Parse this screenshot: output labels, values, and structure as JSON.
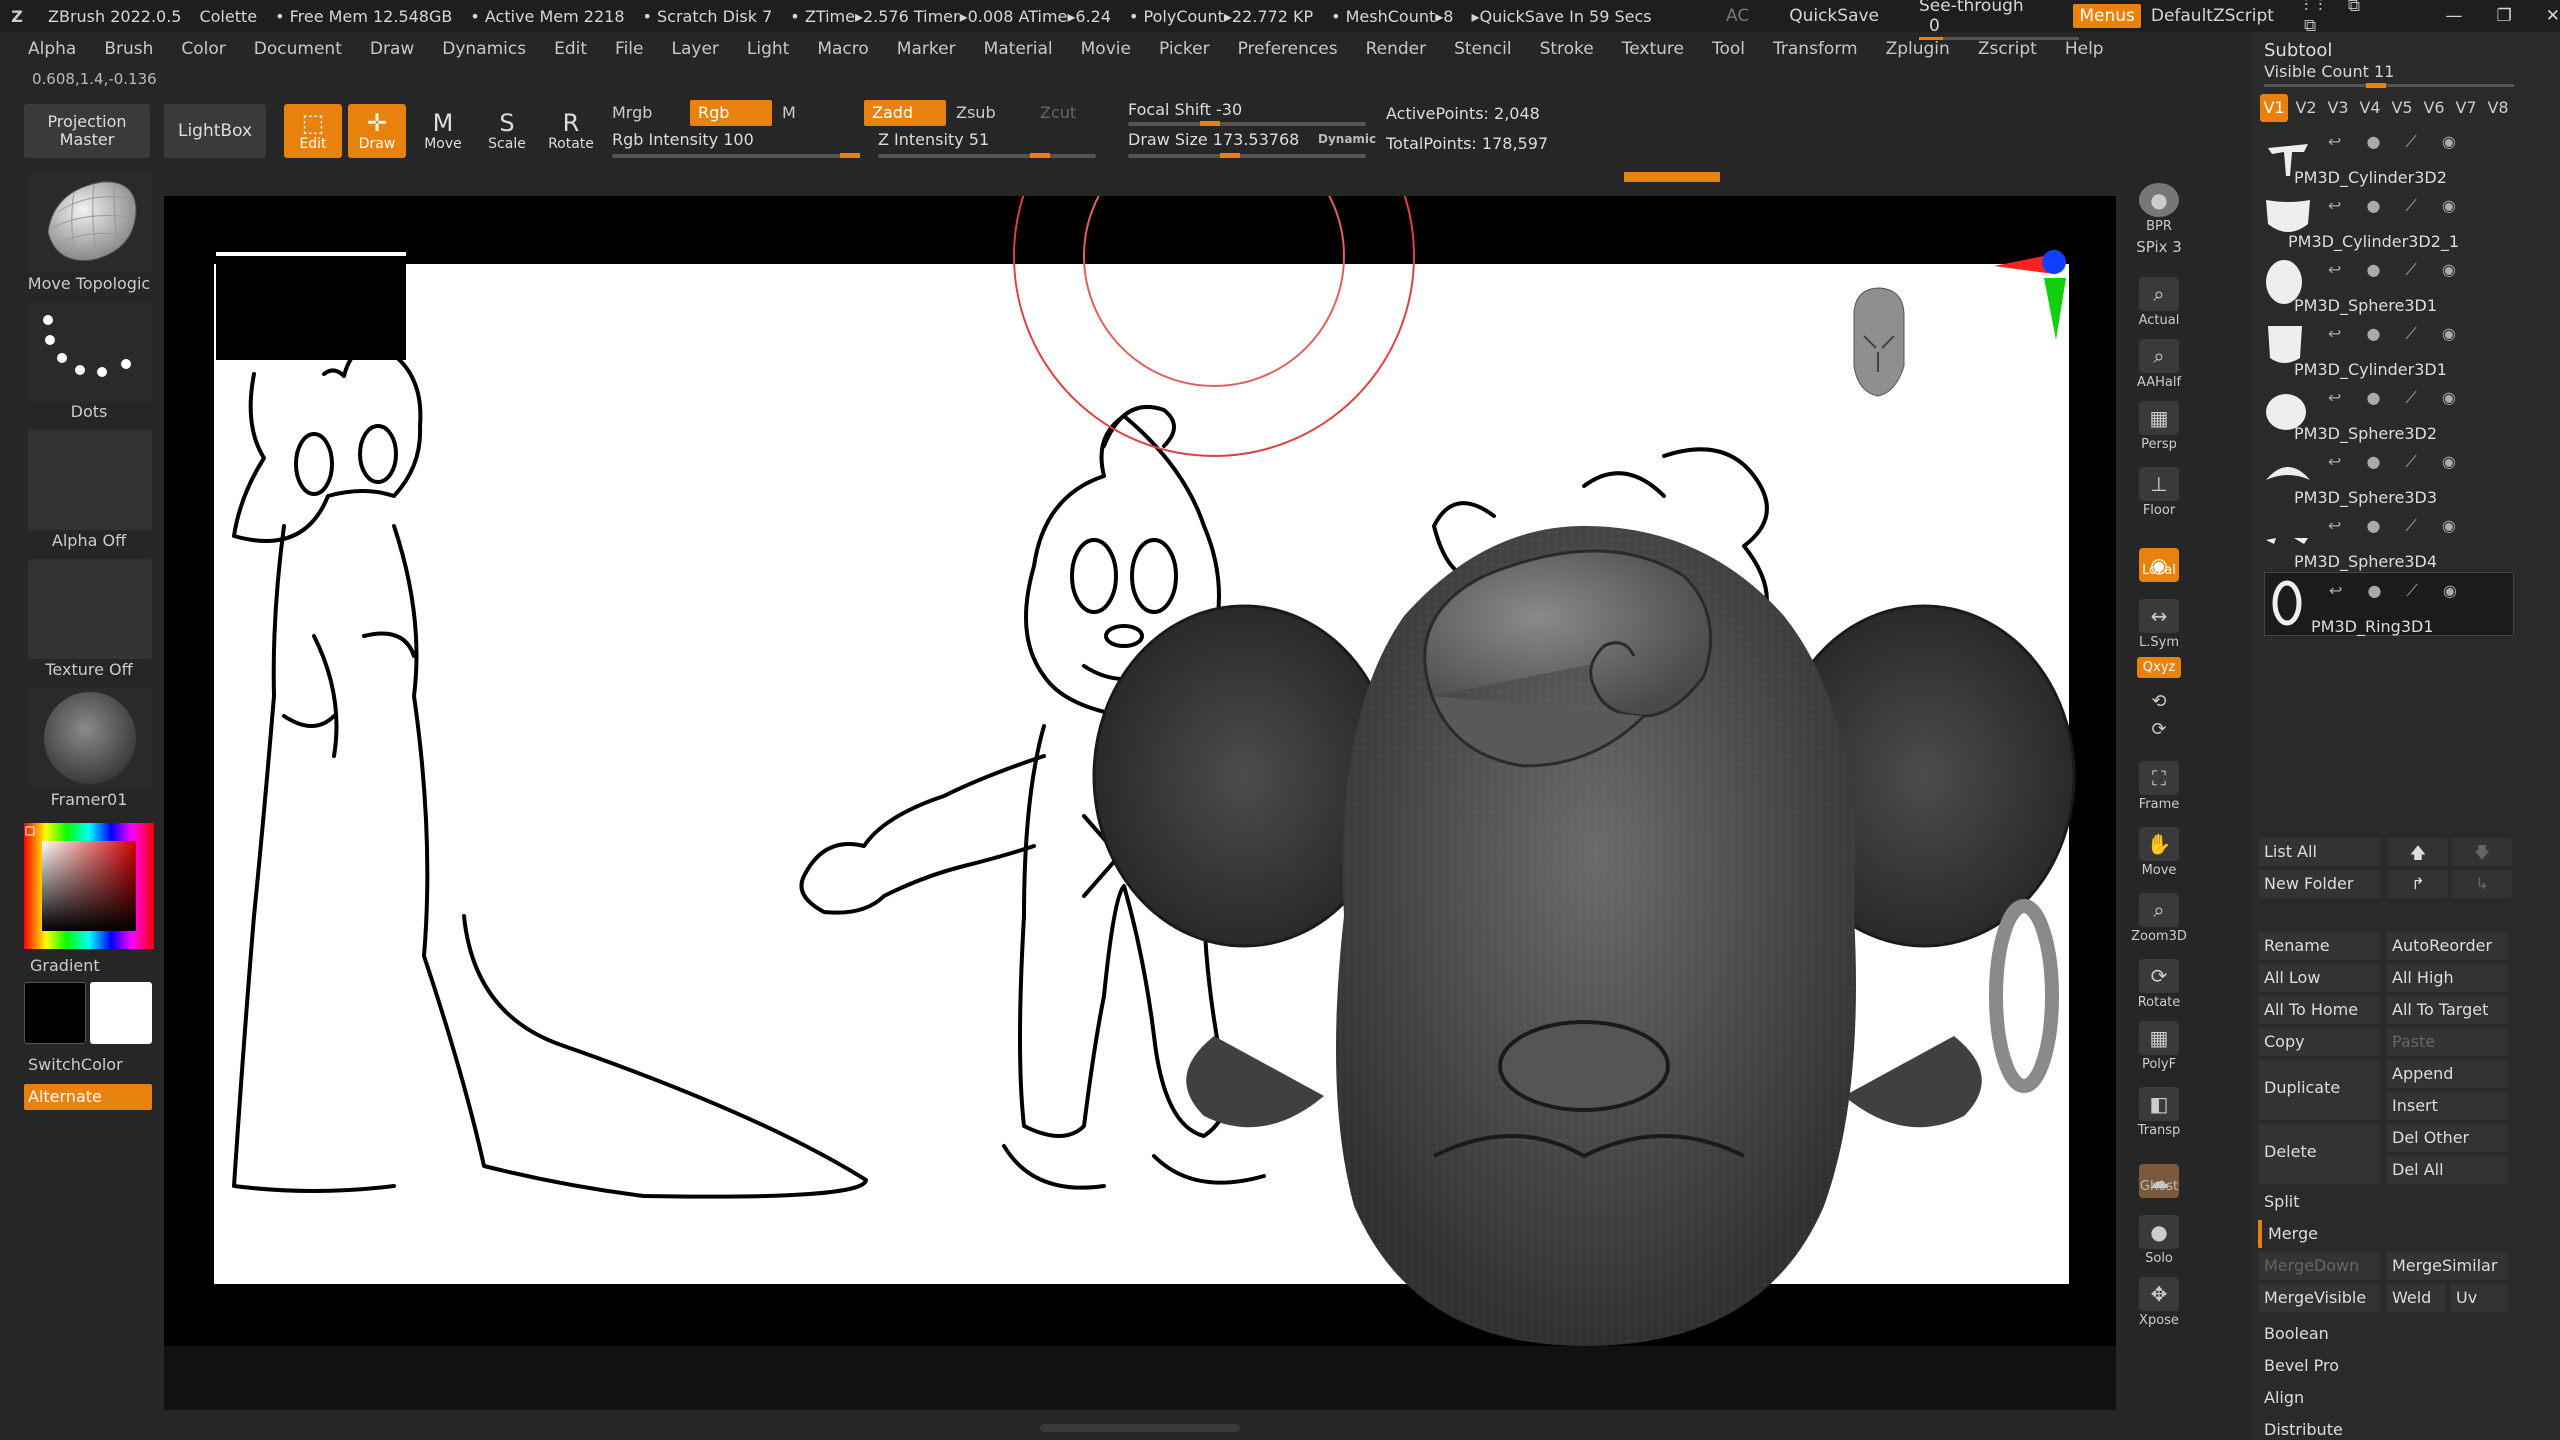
{
  "titlebar": {
    "app": "ZBrush 2022.0.5",
    "project": "Colette",
    "free_mem": "• Free Mem 12.548GB",
    "active_mem": "• Active Mem 2218",
    "scratch": "• Scratch Disk 7",
    "ztime": "• ZTime▸2.576 Timer▸0.008 ATime▸6.24",
    "polycount": "• PolyCount▸22.772 KP",
    "meshcount": "• MeshCount▸8",
    "quicksave_timer": "▸QuickSave In 59 Secs",
    "ac": "AC",
    "quicksave": "QuickSave",
    "seethrough_label": "See-through",
    "seethrough_value": "0",
    "menus": "Menus",
    "script": "DefaultZScript"
  },
  "menubar": [
    "Alpha",
    "Brush",
    "Color",
    "Document",
    "Draw",
    "Dynamics",
    "Edit",
    "File",
    "Layer",
    "Light",
    "Macro",
    "Marker",
    "Material",
    "Movie",
    "Picker",
    "Preferences",
    "Render",
    "Stencil",
    "Stroke",
    "Texture",
    "Tool",
    "Transform",
    "Zplugin",
    "Zscript",
    "Help"
  ],
  "coords": "0.608,1.4,-0.136",
  "toolbar": {
    "projection_master": "Projection Master",
    "lightbox": "LightBox",
    "edit": "Edit",
    "draw": "Draw",
    "move": "Move",
    "scale": "Scale",
    "rotate": "Rotate",
    "mrgb": "Mrgb",
    "rgb": "Rgb",
    "m": "M",
    "rgb_intensity": "Rgb Intensity 100",
    "zadd": "Zadd",
    "zsub": "Zsub",
    "zcut": "Zcut",
    "z_intensity": "Z Intensity 51",
    "focal_shift": "Focal Shift -30",
    "draw_size": "Draw Size 173.53768",
    "dynamic": "Dynamic",
    "active_points": "ActivePoints: 2,048",
    "total_points": "TotalPoints: 178,597"
  },
  "leftshelf": {
    "brush": "Move Topologic",
    "stroke": "Dots",
    "alpha": "Alpha Off",
    "texture": "Texture Off",
    "material": "Framer01",
    "gradient": "Gradient",
    "switchcolor": "SwitchColor",
    "alternate": "Alternate"
  },
  "rightcol": [
    "BPR",
    "SPix 3",
    "Actual",
    "AAHalf",
    "Persp",
    "Floor",
    "Local",
    "L.Sym",
    "Qxyz",
    "Frame",
    "Move",
    "Zoom3D",
    "Rotate",
    "PolyF",
    "Transp",
    "Ghost",
    "Solo",
    "Xpose"
  ],
  "subtool": {
    "title": "Subtool",
    "visible_count": "Visible Count 11",
    "vtabs": [
      "V1",
      "V2",
      "V3",
      "V4",
      "V5",
      "V6",
      "V7",
      "V8"
    ],
    "items": [
      "PM3D_Cylinder3D2",
      "PM3D_Cylinder3D2_1",
      "PM3D_Sphere3D1",
      "PM3D_Cylinder3D1",
      "PM3D_Sphere3D2",
      "PM3D_Sphere3D3",
      "PM3D_Sphere3D4",
      "PM3D_Ring3D1"
    ],
    "buttons": {
      "list_all": "List All",
      "new_folder": "New Folder",
      "rename": "Rename",
      "autoreorder": "AutoReorder",
      "all_low": "All Low",
      "all_high": "All High",
      "all_to_home": "All To Home",
      "all_to_target": "All To Target",
      "copy": "Copy",
      "paste": "Paste",
      "duplicate": "Duplicate",
      "append": "Append",
      "insert": "Insert",
      "delete": "Delete",
      "del_other": "Del Other",
      "del_all": "Del All",
      "split": "Split",
      "merge": "Merge",
      "mergedown": "MergeDown",
      "mergesimilar": "MergeSimilar",
      "mergevisible": "MergeVisible",
      "weld": "Weld",
      "uv": "Uv",
      "boolean": "Boolean",
      "bevel_pro": "Bevel Pro",
      "align": "Align",
      "distribute": "Distribute"
    }
  },
  "colors": {
    "accent": "#e8820c",
    "bg": "#262626",
    "panel": "#2a2a2a"
  }
}
